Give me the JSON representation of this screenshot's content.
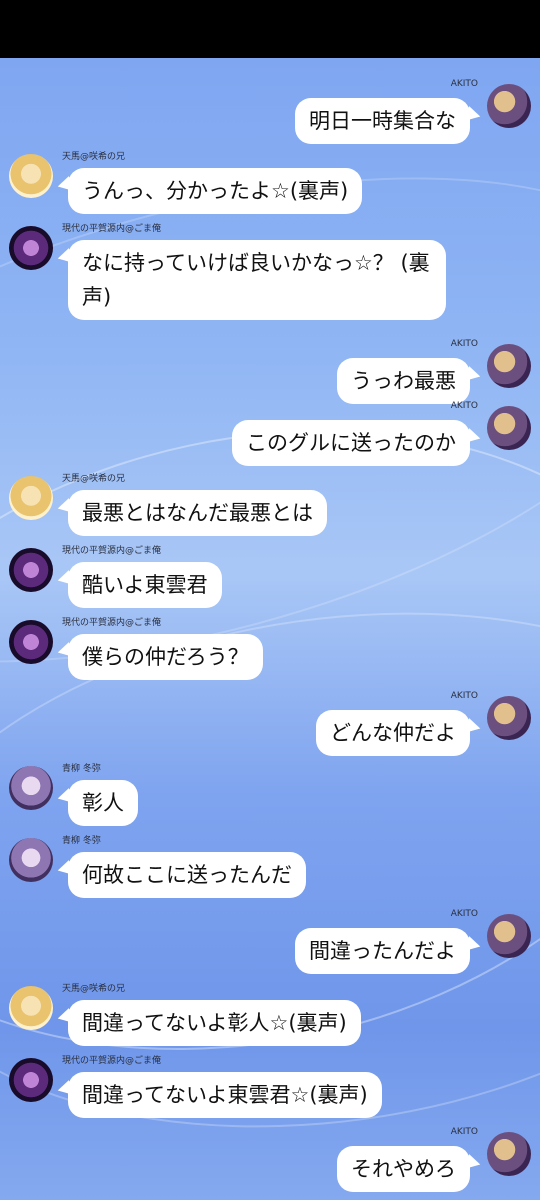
{
  "colors": {
    "background": "#8fb5f4",
    "bubble": "#ffffff",
    "top_bar": "#000000"
  },
  "messages": [
    {
      "side": "right",
      "sender": "AKITO",
      "avatar": "akito-avatar",
      "text": "明日一時集合な"
    },
    {
      "side": "left",
      "sender": "天馬@咲希の兄",
      "avatar": "tenma-avatar",
      "text": "うんっ、分かったよ☆(裏声)"
    },
    {
      "side": "left",
      "sender": "現代の平賀源内@ごま俺",
      "avatar": "toya-dark-avatar",
      "text": "なに持っていけば良いかなっ☆？ (裏声)"
    },
    {
      "side": "right",
      "sender": "AKITO",
      "avatar": "akito-avatar",
      "text": "うっわ最悪"
    },
    {
      "side": "right",
      "sender": "AKITO",
      "avatar": "akito-avatar",
      "text": "このグルに送ったのか"
    },
    {
      "side": "left",
      "sender": "天馬@咲希の兄",
      "avatar": "tenma-avatar",
      "text": "最悪とはなんだ最悪とは"
    },
    {
      "side": "left",
      "sender": "現代の平賀源内@ごま俺",
      "avatar": "toya-dark-avatar",
      "text": "酷いよ東雲君"
    },
    {
      "side": "left",
      "sender": "現代の平賀源内@ごま俺",
      "avatar": "toya-dark-avatar",
      "text": "僕らの仲だろう？"
    },
    {
      "side": "right",
      "sender": "AKITO",
      "avatar": "akito-avatar",
      "text": "どんな仲だよ"
    },
    {
      "side": "left",
      "sender": "青柳 冬弥",
      "avatar": "aoyagi-avatar",
      "text": "彰人"
    },
    {
      "side": "left",
      "sender": "青柳 冬弥",
      "avatar": "aoyagi-avatar",
      "text": "何故ここに送ったんだ"
    },
    {
      "side": "right",
      "sender": "AKITO",
      "avatar": "akito-avatar",
      "text": "間違ったんだよ"
    },
    {
      "side": "left",
      "sender": "天馬@咲希の兄",
      "avatar": "tenma-avatar",
      "text": "間違ってないよ彰人☆(裏声)"
    },
    {
      "side": "left",
      "sender": "現代の平賀源内@ごま俺",
      "avatar": "toya-dark-avatar",
      "text": "間違ってないよ東雲君☆(裏声)"
    },
    {
      "side": "right",
      "sender": "AKITO",
      "avatar": "akito-avatar",
      "text": "それやめろ"
    }
  ]
}
